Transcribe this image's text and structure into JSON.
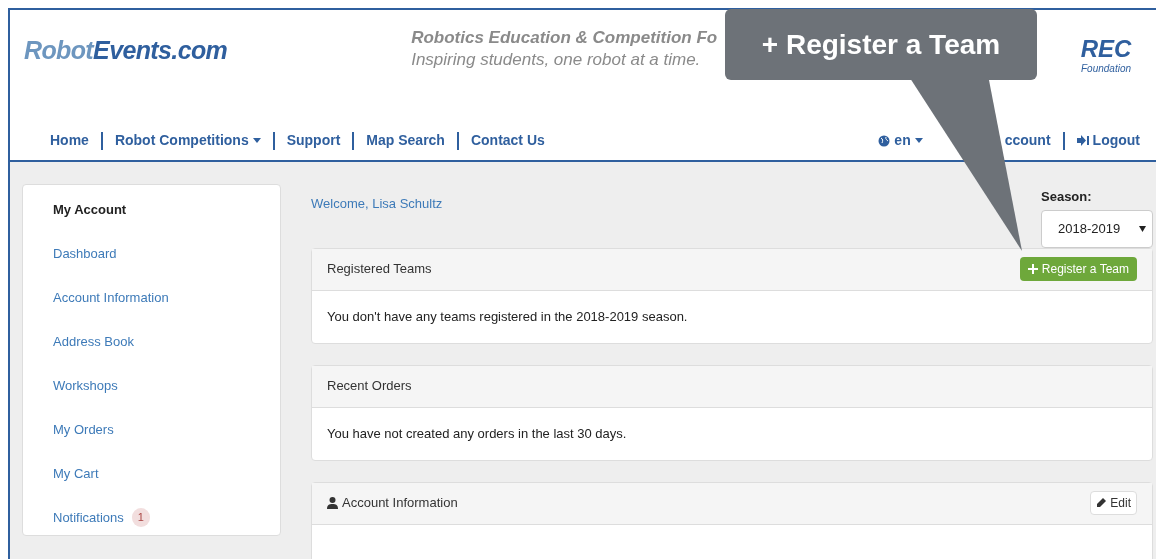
{
  "header": {
    "logo": {
      "part1": "Robot",
      "part2": "Events.com"
    },
    "tagline": [
      "Robotics Education & Competition Fo",
      "Inspiring students, one robot at a time."
    ],
    "rec_logo": {
      "text": "REC",
      "subtext": "Foundation"
    }
  },
  "nav": {
    "left": [
      {
        "label": "Home",
        "caret": false
      },
      {
        "label": "Robot Competitions",
        "caret": true
      },
      {
        "label": "Support",
        "caret": false
      },
      {
        "label": "Map Search",
        "caret": false
      },
      {
        "label": "Contact Us",
        "caret": false
      }
    ],
    "language": "en",
    "account": "ccount",
    "logout": "Logout"
  },
  "callout": "+ Register a Team",
  "sidebar": {
    "title": "My Account",
    "items": [
      {
        "label": "Dashboard"
      },
      {
        "label": "Account Information"
      },
      {
        "label": "Address Book"
      },
      {
        "label": "Workshops"
      },
      {
        "label": "My Orders"
      },
      {
        "label": "My Cart"
      },
      {
        "label": "Notifications",
        "badge": "1"
      }
    ]
  },
  "welcome": "Welcome, Lisa Schultz",
  "season": {
    "label": "Season:",
    "value": "2018-2019"
  },
  "panels": [
    {
      "title": "Registered Teams",
      "button": {
        "kind": "add",
        "label": "Register a Team"
      },
      "body": "You don't have any teams registered in the 2018-2019 season."
    },
    {
      "title": "Recent Orders",
      "body": "You have not created any orders in the last 30 days."
    },
    {
      "title": "Account Information",
      "kind": "profile",
      "button": {
        "kind": "edit",
        "label": "Edit"
      }
    }
  ]
}
